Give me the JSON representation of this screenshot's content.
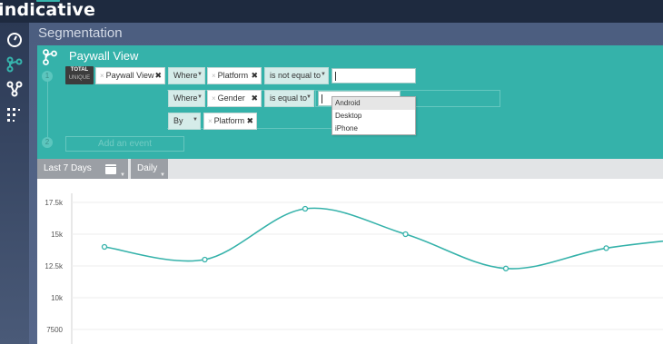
{
  "app": {
    "logo_text": "indicative",
    "page_title": "Segmentation"
  },
  "nav": {
    "items": [
      {
        "icon": "dashboard-icon"
      },
      {
        "icon": "segmentation-icon",
        "active": true
      },
      {
        "icon": "funnel-icon"
      },
      {
        "icon": "cohort-icon"
      }
    ]
  },
  "query": {
    "title": "Paywall View",
    "step_numbers": [
      "1",
      "2"
    ],
    "badge": {
      "line1": "TOTAL",
      "line2": "UNIQUE"
    },
    "event_chip": "Paywall View",
    "filters": [
      {
        "keyword": "Where",
        "property": "Platform",
        "operator": "is not equal to",
        "value": ""
      },
      {
        "keyword": "Where",
        "property": "Gender",
        "operator": "is equal to",
        "value": ""
      }
    ],
    "group_by": {
      "keyword": "By",
      "property": "Platform"
    },
    "add_event_placeholder": "Add an event",
    "dropdown_options": [
      "Android",
      "Desktop",
      "iPhone"
    ],
    "dropdown_highlighted": "Android"
  },
  "date_controls": {
    "range_label": "Last 7 Days",
    "interval_label": "Daily"
  },
  "colors": {
    "teal": "#35b2aa",
    "line": "#35b2aa",
    "topbar": "#1e2a3f"
  },
  "chart_data": {
    "type": "line",
    "y_tick_labels": [
      "17.5k",
      "15k",
      "12.5k",
      "10k",
      "7500"
    ],
    "ylim": [
      7500,
      17500
    ],
    "grid": true,
    "series": [
      {
        "values": [
          14000,
          13000,
          17000,
          15000,
          12300,
          13900,
          14800
        ]
      }
    ]
  }
}
